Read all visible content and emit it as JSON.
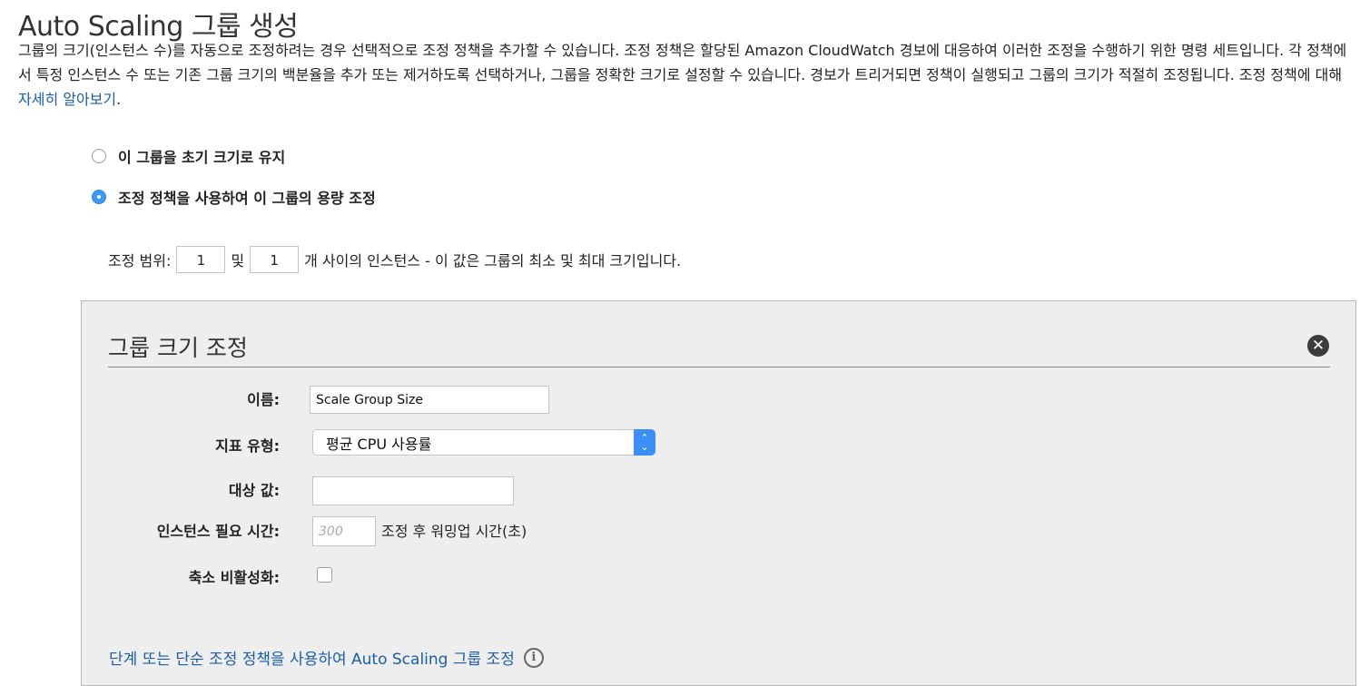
{
  "page": {
    "title": "Auto Scaling 그룹 생성",
    "description": "그룹의 크기(인스턴스 수)를 자동으로 조정하려는 경우 선택적으로 조정 정책을 추가할 수 있습니다. 조정 정책은 할당된 Amazon CloudWatch 경보에 대응하여 이러한 조정을 수행하기 위한 명령 세트입니다. 각 정책에서 특정 인스턴스 수 또는 기존 그룹 크기의 백분율을 추가 또는 제거하도록 선택하거나, 그룹을 정확한 크기로 설정할 수 있습니다. 경보가 트리거되면 정책이 실행되고 그룹의 크기가 적절히 조정됩니다. 조정 정책에 대해",
    "learn_more": "자세히 알아보기",
    "learn_more_suffix": "."
  },
  "options": {
    "keep_initial": "이 그룹을 초기 크기로 유지",
    "use_policies": "조정 정책을 사용하여 이 그룹의 용량 조정",
    "selected": "use_policies"
  },
  "range": {
    "prefix": "조정 범위:",
    "min": "1",
    "and": "및",
    "max": "1",
    "suffix": "개 사이의 인스턴스 - 이 값은 그룹의 최소 및 최대 크기입니다."
  },
  "panel": {
    "title": "그룹 크기 조정",
    "name_label": "이름:",
    "name_value": "Scale Group Size",
    "metric_label": "지표 유형:",
    "metric_value": "평균 CPU 사용률",
    "target_label": "대상 값:",
    "target_value": "",
    "warmup_label": "인스턴스 필요 시간:",
    "warmup_placeholder": "300",
    "warmup_suffix": "조정 후 워밍업 시간(초)",
    "disable_scalein_label": "축소 비활성화:",
    "disable_scalein_checked": false,
    "footer_link": "단계 또는 단순 조정 정책을 사용하여 Auto Scaling 그룹 조정"
  },
  "icons": {
    "close": "close-icon",
    "info": "info-icon",
    "select_arrows": "chevron-updown-icon"
  },
  "colors": {
    "link": "#1a5ea8",
    "radio_selected": "#3b99fc",
    "select_arrow_bg": "#3b8ff6",
    "panel_bg": "#eeeeee"
  }
}
